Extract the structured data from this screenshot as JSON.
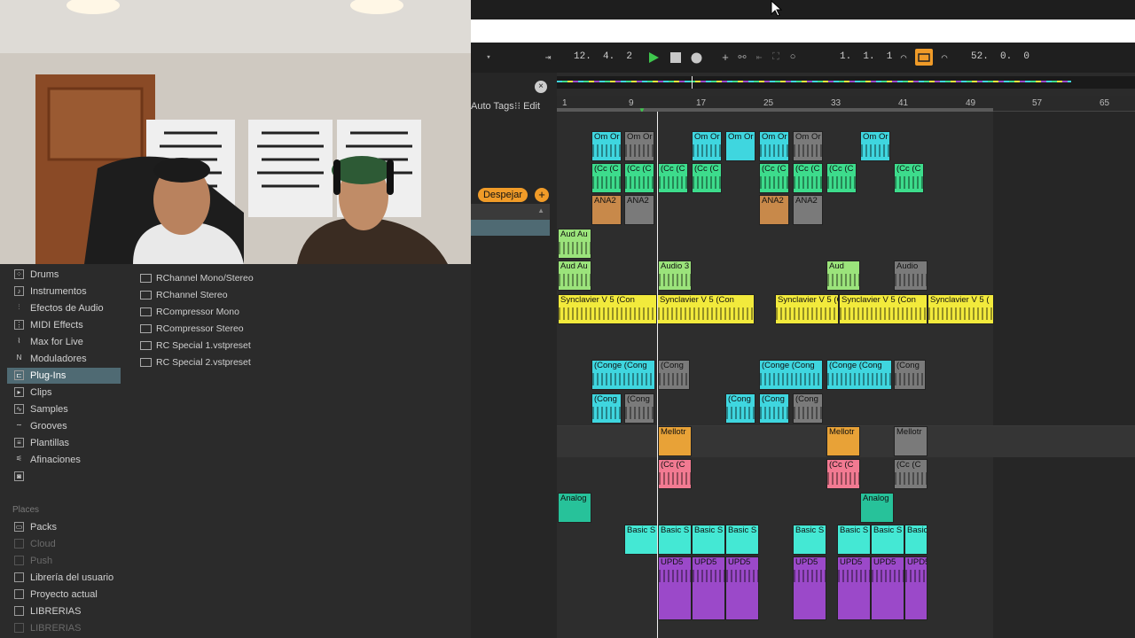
{
  "transport": {
    "arrangement_position": "12.  4.  2",
    "loop_start": "1.  1.  1",
    "loop_length": "52.  0.  0"
  },
  "browser_header": {
    "auto_tags": "Auto Tags",
    "edit": "Edit",
    "clear_button": "Despejar"
  },
  "ruler": {
    "bars": [
      "1",
      "9",
      "17",
      "25",
      "33",
      "41",
      "49",
      "57",
      "65"
    ]
  },
  "categories": [
    {
      "label": "Drums",
      "icon": "drums-icon"
    },
    {
      "label": "Instrumentos",
      "icon": "instruments-icon"
    },
    {
      "label": "Efectos de Audio",
      "icon": "audio-effects-icon"
    },
    {
      "label": "MIDI Effects",
      "icon": "midi-effects-icon"
    },
    {
      "label": "Max for Live",
      "icon": "max-for-live-icon"
    },
    {
      "label": "Moduladores",
      "icon": "modulators-icon"
    },
    {
      "label": "Plug-Ins",
      "icon": "plugins-icon"
    },
    {
      "label": "Clips",
      "icon": "clips-icon"
    },
    {
      "label": "Samples",
      "icon": "samples-icon"
    },
    {
      "label": "Grooves",
      "icon": "grooves-icon"
    },
    {
      "label": "Plantillas",
      "icon": "templates-icon"
    },
    {
      "label": "Afinaciones",
      "icon": "tunings-icon"
    }
  ],
  "places_header": "Places",
  "places": [
    {
      "label": "Packs"
    },
    {
      "label": "Cloud"
    },
    {
      "label": "Push"
    },
    {
      "label": "Librería del usuario"
    },
    {
      "label": "Proyecto actual"
    },
    {
      "label": "LIBRERIAS"
    },
    {
      "label": "LIBRERIAS"
    }
  ],
  "files": [
    {
      "label": "RChannel Mono/Stereo"
    },
    {
      "label": "RChannel Stereo"
    },
    {
      "label": "RCompressor Mono"
    },
    {
      "label": "RCompressor Stereo"
    },
    {
      "label": "RC Special 1.vstpreset"
    },
    {
      "label": "RC Special 2.vstpreset"
    }
  ],
  "clips": {
    "om": "Om Or",
    "cc": "(Cc (C",
    "ana2": "ANA2",
    "aud": "Aud Au",
    "audio3": "Audio 3",
    "audio": "Audio",
    "synclavier": "Synclavier V 5 (Con",
    "synclavier_b": "Synclavier V 5 (",
    "conga": "(Conge (Cong",
    "conga_short": "(Cong",
    "mellotron": "Mellotr",
    "analog": "Analog",
    "basic": "Basic S",
    "upd": "UPD5",
    "aud_short": "Aud"
  },
  "colors": {
    "cyan": "#3fd6df",
    "green": "#3ddc8c",
    "tan": "#c8894a",
    "lime": "#9be37b",
    "yellow": "#f2ea3c",
    "orange": "#e8a237",
    "pink": "#f27a92",
    "teal": "#27c29a",
    "aqua": "#44e8d4",
    "purple": "#9b49c9",
    "gray": "#7a7a7a",
    "loop": "#f09b28",
    "play": "#3ec74d"
  }
}
